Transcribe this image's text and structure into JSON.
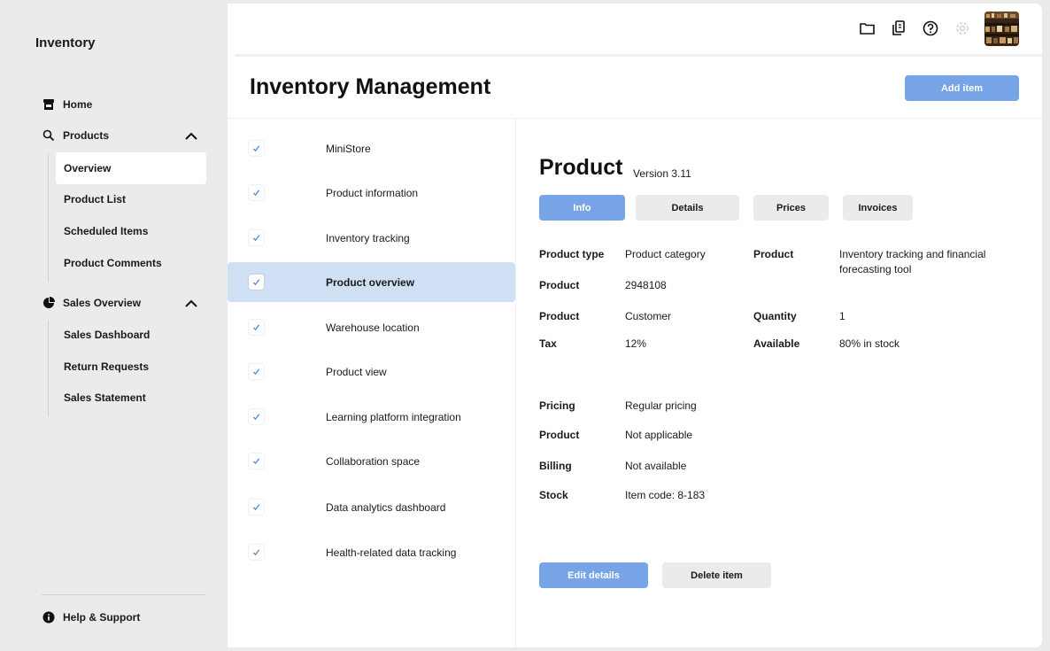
{
  "sidebar": {
    "app_title": "Inventory",
    "home": "Home",
    "products": "Products",
    "product_items": [
      "Overview",
      "Product List",
      "Scheduled Items",
      "Product Comments"
    ],
    "sales": "Sales Overview",
    "sales_items": [
      "Sales Dashboard",
      "Return Requests",
      "Sales Statement"
    ],
    "help": "Help & Support"
  },
  "header": {
    "icons": [
      "folder-icon",
      "documents-icon",
      "help-icon",
      "settings-icon"
    ],
    "avatar": "user-avatar"
  },
  "main": {
    "title": "Inventory Management",
    "add_button": "Add item"
  },
  "list": {
    "items": [
      "MiniStore",
      "Product information",
      "Inventory tracking",
      "Product overview",
      "Warehouse location",
      "Product view",
      "Learning platform integration",
      "Collaboration space",
      "Data analytics dashboard",
      "Health-related data tracking"
    ],
    "selected_index": 3
  },
  "detail": {
    "title": "Product",
    "version": "Version 3.11",
    "tabs": [
      "Info",
      "Details",
      "Prices",
      "Invoices"
    ],
    "active_tab": "Info",
    "fields": {
      "product_type_label": "Product type",
      "product_type_value": "Product category",
      "product_right_label": "Product",
      "product_right_value": "Inventory tracking and financial forecasting tool",
      "product_id_label": "Product",
      "product_id_value": "2948108",
      "product_customer_label": "Product",
      "product_customer_value": "Customer",
      "quantity_label": "Quantity",
      "quantity_value": "1",
      "tax_label": "Tax",
      "tax_value": "12%",
      "available_label": "Available",
      "available_value": "80% in stock",
      "pricing_label": "Pricing",
      "pricing_value": "Regular pricing",
      "product_na_label": "Product",
      "product_na_value": "Not applicable",
      "billing_label": "Billing",
      "billing_value": "Not available",
      "stock_label": "Stock",
      "stock_value": "Item code: 8-183"
    },
    "edit_button": "Edit details",
    "delete_button": "Delete item"
  },
  "colors": {
    "accent": "#77a4e6",
    "selected_row": "#cfdff4",
    "background": "#ebebeb"
  }
}
